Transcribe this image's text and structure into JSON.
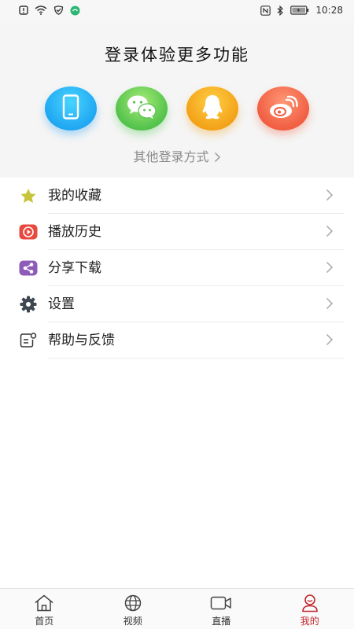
{
  "status_bar": {
    "time": "10:28",
    "battery_icon": "battery-icon",
    "wifi_icon": "wifi-icon"
  },
  "login": {
    "title": "登录体验更多功能",
    "other_methods": "其他登录方式",
    "options": [
      {
        "id": "phone",
        "icon": "phone-icon",
        "color": "#20a7f2"
      },
      {
        "id": "wechat",
        "icon": "wechat-icon",
        "color": "#53c24c"
      },
      {
        "id": "qq",
        "icon": "qq-icon",
        "color": "#f3a218"
      },
      {
        "id": "weibo",
        "icon": "weibo-icon",
        "color": "#f15e42"
      }
    ]
  },
  "menu": {
    "items": [
      {
        "label": "我的收藏",
        "icon": "star-icon",
        "color": "#c6c43a"
      },
      {
        "label": "播放历史",
        "icon": "play-history-icon",
        "color": "#e8493f"
      },
      {
        "label": "分享下载",
        "icon": "share-icon",
        "color": "#8e5bb8"
      },
      {
        "label": "设置",
        "icon": "gear-icon",
        "color": "#3f4750"
      },
      {
        "label": "帮助与反馈",
        "icon": "feedback-icon",
        "color": "#333333"
      }
    ]
  },
  "tabs": {
    "items": [
      {
        "label": "首页",
        "icon": "home-icon",
        "active": false
      },
      {
        "label": "视频",
        "icon": "globe-icon",
        "active": false
      },
      {
        "label": "直播",
        "icon": "video-camera-icon",
        "active": false
      },
      {
        "label": "我的",
        "icon": "user-icon",
        "active": true
      }
    ],
    "active_color": "#c0252b"
  }
}
